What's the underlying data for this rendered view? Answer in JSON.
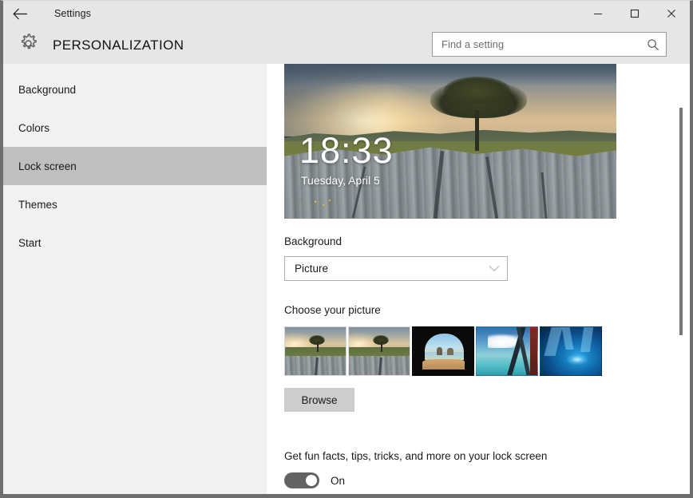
{
  "titlebar": {
    "back_icon": "back-arrow-icon",
    "app_title": "Settings",
    "minimize_label": "—",
    "maximize_label": "□",
    "close_label": "✕"
  },
  "header": {
    "gear_icon": "gear-icon",
    "page_title": "PERSONALIZATION"
  },
  "search": {
    "placeholder": "Find a setting",
    "value": "",
    "icon": "search-icon"
  },
  "sidebar": {
    "items": [
      {
        "label": "Background",
        "selected": false
      },
      {
        "label": "Colors",
        "selected": false
      },
      {
        "label": "Lock screen",
        "selected": true
      },
      {
        "label": "Themes",
        "selected": false
      },
      {
        "label": "Start",
        "selected": false
      }
    ]
  },
  "main": {
    "preview": {
      "time": "18:33",
      "date": "Tuesday, April 5",
      "description": "limestone-pavement-tree-sunset"
    },
    "background_section": {
      "label": "Background",
      "selected_option": "Picture",
      "chevron_icon": "chevron-down-icon"
    },
    "choose_picture": {
      "label": "Choose your picture",
      "thumbnails": [
        {
          "name": "limestone-tree-sunset-1",
          "selected": true
        },
        {
          "name": "limestone-tree-sunset-2",
          "selected": false
        },
        {
          "name": "cave-beach-sea-stacks",
          "selected": false
        },
        {
          "name": "sky-structure-over-water",
          "selected": false
        },
        {
          "name": "blue-ice-cave",
          "selected": false
        }
      ],
      "browse_label": "Browse"
    },
    "fun_facts": {
      "label": "Get fun facts, tips, tricks, and more on your lock screen",
      "toggle_state": "On",
      "toggle_on": true
    }
  },
  "colors": {
    "titlebar_bg": "#e6e6e6",
    "sidebar_bg": "#f1f1f1",
    "sidebar_selected_bg": "#bfbfbf",
    "content_bg": "#ffffff",
    "window_border": "#6e6e6e",
    "toggle_on_bg": "#636363",
    "browse_btn_bg": "#cdcdcd",
    "text_primary": "#1a1a1a"
  }
}
